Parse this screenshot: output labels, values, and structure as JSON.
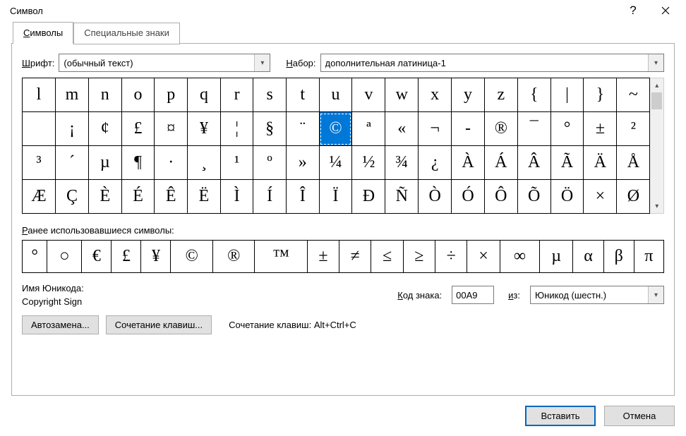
{
  "title": "Символ",
  "tabs": {
    "symbols": "Символы",
    "special": "Специальные знаки"
  },
  "labels": {
    "font": "Шрифт:",
    "subset": "Набор:",
    "recent": "Ранее использовавшиеся символы:",
    "unicodeNameLabel": "Имя Юникода:",
    "charCode": "Код знака:",
    "from": "из:",
    "shortcutPrefix": "Сочетание клавиш:"
  },
  "values": {
    "font": "(обычный текст)",
    "subset": "дополнительная латиница-1",
    "unicodeName": "Copyright Sign",
    "charCode": "00A9",
    "fromSet": "Юникод (шестн.)",
    "shortcut": "Alt+Ctrl+C"
  },
  "buttons": {
    "autocorrect": "Автозамена...",
    "shortcutKey": "Сочетание клавиш...",
    "insert": "Вставить",
    "cancel": "Отмена"
  },
  "grid": [
    [
      "l",
      "m",
      "n",
      "o",
      "p",
      "q",
      "r",
      "s",
      "t",
      "u",
      "v",
      "w",
      "x",
      "y",
      "z",
      "{",
      "|",
      "}",
      "~"
    ],
    [
      "",
      "¡",
      "¢",
      "£",
      "¤",
      "¥",
      "¦",
      "§",
      "¨",
      "©",
      "ª",
      "«",
      "¬",
      "-",
      "®",
      "¯",
      "°",
      "±",
      "²"
    ],
    [
      "³",
      "´",
      "µ",
      "¶",
      "·",
      "¸",
      "¹",
      "º",
      "»",
      "¼",
      "½",
      "¾",
      "¿",
      "À",
      "Á",
      "Â",
      "Ã",
      "Ä",
      "Å"
    ],
    [
      "Æ",
      "Ç",
      "È",
      "É",
      "Ê",
      "Ë",
      "Ì",
      "Í",
      "Î",
      "Ï",
      "Ð",
      "Ñ",
      "Ò",
      "Ó",
      "Ô",
      "Õ",
      "Ö",
      "×",
      "Ø"
    ]
  ],
  "selected": {
    "row": 1,
    "col": 9
  },
  "recent": [
    "°",
    "○",
    "€",
    "£",
    "¥",
    "©",
    "®",
    "™",
    "±",
    "≠",
    "≤",
    "≥",
    "÷",
    "×",
    "∞",
    "µ",
    "α",
    "β",
    "π"
  ]
}
